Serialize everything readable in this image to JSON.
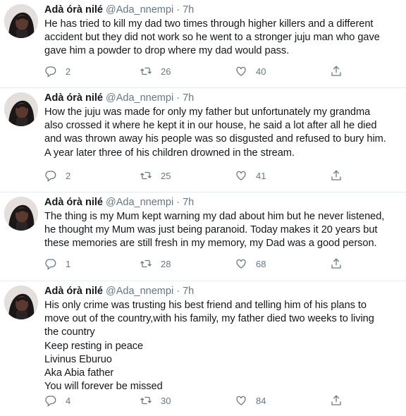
{
  "tweets": [
    {
      "name": "Adà órà nilé",
      "handle": "@Ada_nnempi",
      "separator": "·",
      "time": "7h",
      "lines": [
        "He has tried to kill my dad two times through higher killers and a different",
        "accident but they did not work so he went to a stronger juju man who gave",
        "gave him a powder to drop where my dad would pass."
      ],
      "replies": "2",
      "retweets": "26",
      "likes": "40"
    },
    {
      "name": "Adà órà nilé",
      "handle": "@Ada_nnempi",
      "separator": "·",
      "time": "7h",
      "lines": [
        "How the juju was made for only my father but unfortunately my grandma",
        "also crossed it where he kept it in our house, he said a lot after all he died",
        "and was thrown away his people was so disgusted and refused to bury him.",
        "A year later three of his children drowned in the stream."
      ],
      "replies": "2",
      "retweets": "25",
      "likes": "41"
    },
    {
      "name": "Adà órà nilé",
      "handle": "@Ada_nnempi",
      "separator": "·",
      "time": "7h",
      "lines": [
        "The thing is my Mum kept warning my dad about him but he never listened,",
        "he thought my Mum was just being paranoid. Today makes it 20 years but",
        "these memories are still fresh in my memory, my Dad was a good person."
      ],
      "replies": "1",
      "retweets": "28",
      "likes": "68"
    },
    {
      "name": "Adà órà nilé",
      "handle": "@Ada_nnempi",
      "separator": "·",
      "time": "7h",
      "lines": [
        "His only crime was trusting his best friend and telling him of his plans to",
        "move out of the country,with his family, my father died two weeks to living",
        "the country",
        "Keep resting in peace",
        "Livinus Eburuo",
        "Aka Abia father",
        "You will forever be missed"
      ],
      "replies": "4",
      "retweets": "30",
      "likes": "84"
    }
  ],
  "icons": {
    "reply": "reply-icon",
    "retweet": "retweet-icon",
    "like": "heart-icon",
    "share": "share-icon"
  },
  "colors": {
    "text": "#14171a",
    "secondary": "#657786",
    "divider": "#e6ecf0"
  }
}
